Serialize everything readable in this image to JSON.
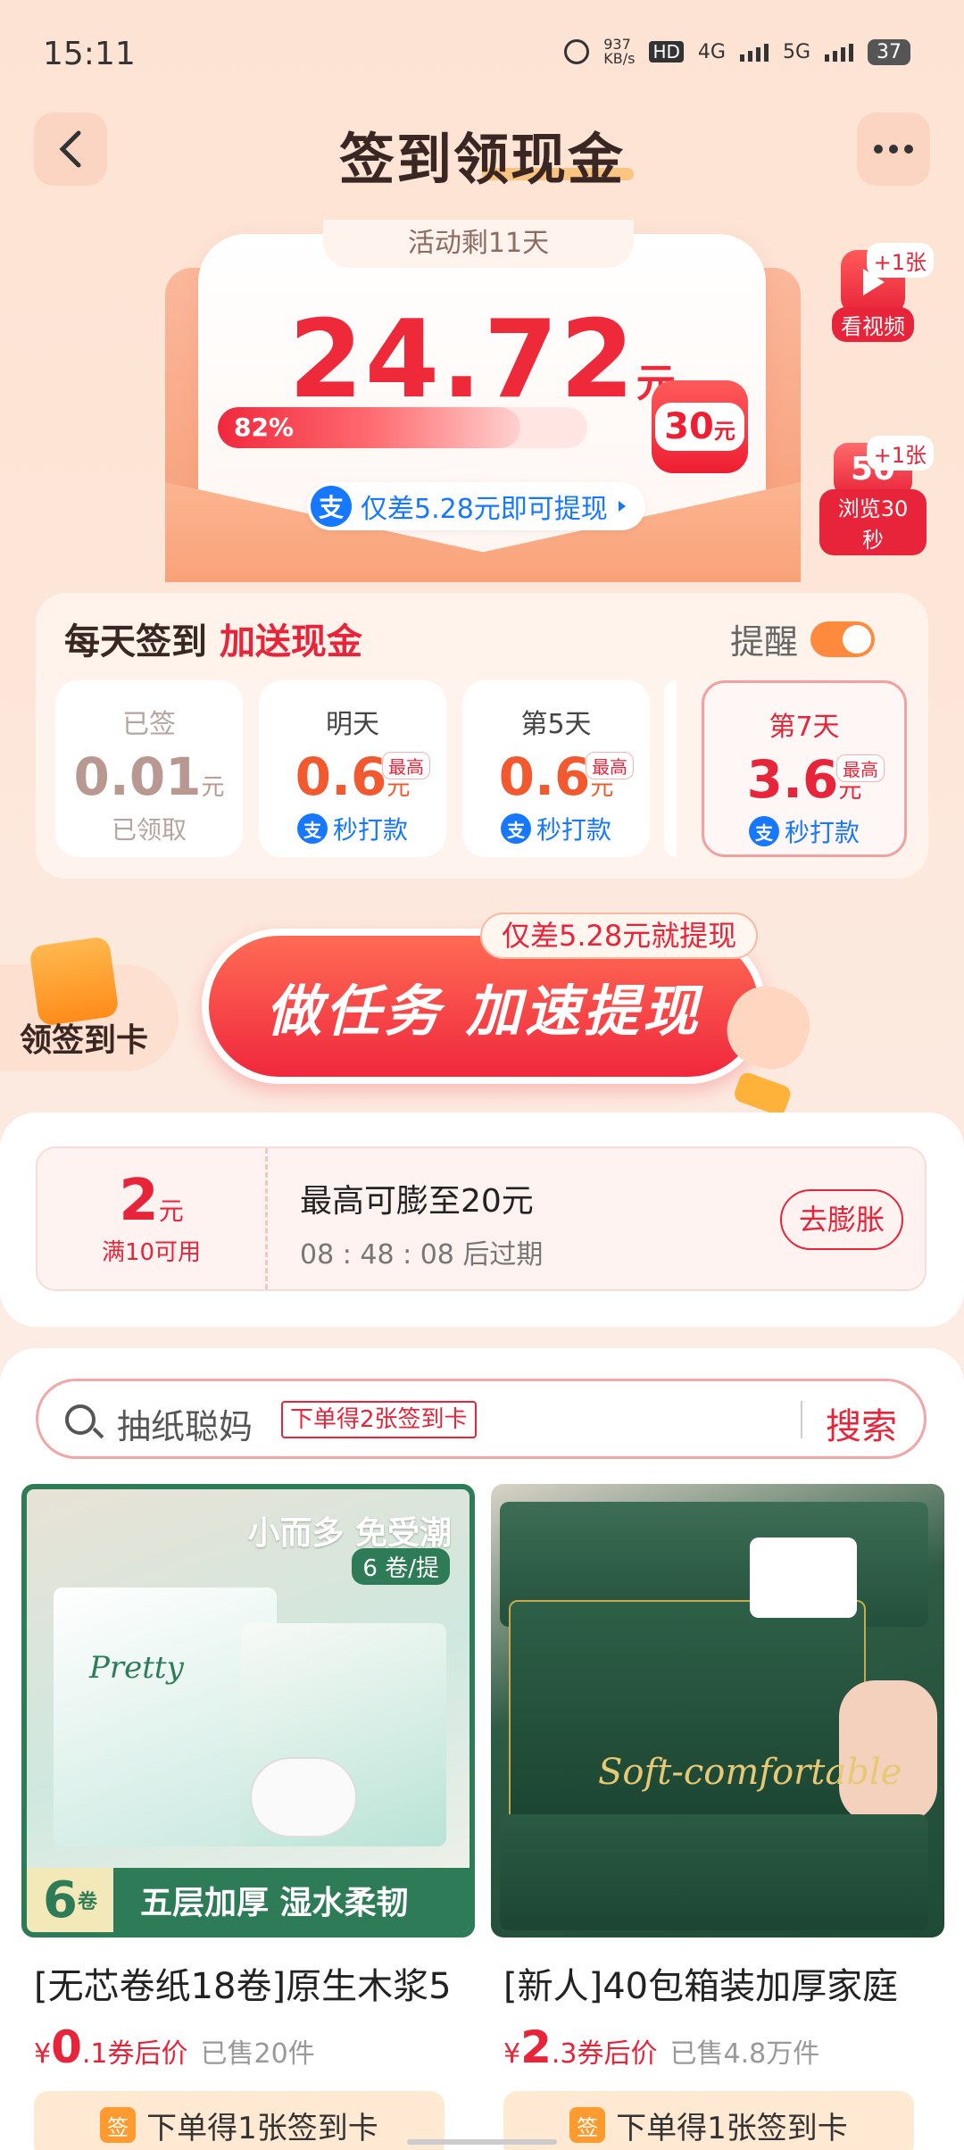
{
  "status_bar": {
    "time": "15:11",
    "net_speed": "937\nKB/s",
    "hd": "HD",
    "sig1": "4G",
    "sig2": "5G",
    "battery": "37"
  },
  "header": {
    "title": "签到领现金"
  },
  "hero": {
    "days_left": "活动剩11天",
    "amount": "24.72",
    "amount_unit": "元",
    "progress_label": "82%",
    "progress_fraction": 0.82,
    "target_value": "30",
    "target_unit": "元",
    "alipay_icon": "支",
    "remaining_text": "仅差5.28元即可提现"
  },
  "side": {
    "video_bonus": "+1张",
    "video_label": "看视频",
    "browse_bonus": "+1张",
    "browse_value": "50",
    "browse_label": "浏览30秒"
  },
  "daily": {
    "title": "每天签到",
    "title_red": "加送现金",
    "remind_label": "提醒",
    "days": [
      {
        "label": "已签",
        "value": "0.01",
        "unit": "元",
        "sub": "已领取"
      },
      {
        "label": "明天",
        "value": "0.6",
        "unit": "元",
        "max": "最高",
        "pay": "秒打款"
      },
      {
        "label": "第5天",
        "value": "0.6",
        "unit": "元",
        "max": "最高",
        "pay": "秒打款"
      },
      {
        "label": "第7天",
        "value": "3.6",
        "unit": "元",
        "max": "最高",
        "pay": "秒打款"
      }
    ]
  },
  "task": {
    "card_label": "领签到卡",
    "button_label": "做任务 加速提现",
    "tip": "仅差5.28元就提现"
  },
  "coupon": {
    "value": "2",
    "unit": "元",
    "condition": "满10可用",
    "title": "最高可膨至20元",
    "expire": "08 : 48 : 08 后过期",
    "action": "去膨胀"
  },
  "search": {
    "placeholder": "抽纸聪妈",
    "chip": "下单得2张签到卡",
    "button": "搜索"
  },
  "products": [
    {
      "img_caption": "小而多 免受潮",
      "img_badge": "6 卷/提",
      "img_num": "6",
      "img_num_unit": "卷",
      "img_bottom": "五层加厚  湿水柔韧",
      "brand": "Pretty",
      "name": "[无芯卷纸18卷]原生木浆5",
      "currency": "¥",
      "price_int": "0",
      "price_dec": ".1",
      "price_note": "券后价",
      "sold": "已售20件",
      "cta_icon": "签",
      "cta": "下单得1张签到卡"
    },
    {
      "brand": "Soft-comfortable",
      "name": "[新人]40包箱装加厚家庭",
      "currency": "¥",
      "price_int": "2",
      "price_dec": ".3",
      "price_note": "券后价",
      "sold": "已售4.8万件",
      "cta_icon": "签",
      "cta": "下单得1张签到卡"
    }
  ],
  "colors": {
    "accent": "#e8243a",
    "alipay": "#1677ff",
    "orange": "#f2592f"
  }
}
